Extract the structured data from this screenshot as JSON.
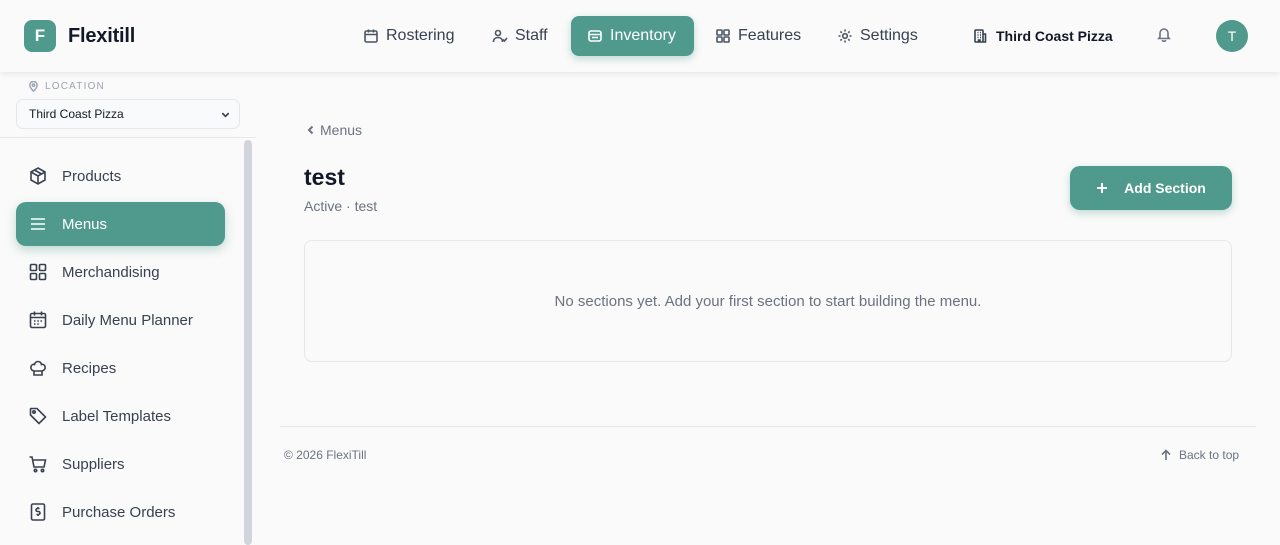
{
  "brand": {
    "logo_letter": "F",
    "name": "Flexitill"
  },
  "nav": {
    "items": [
      {
        "label": "Rostering",
        "icon": "calendar-icon"
      },
      {
        "label": "Staff",
        "icon": "users-icon"
      },
      {
        "label": "Inventory",
        "icon": "box-icon"
      },
      {
        "label": "Features",
        "icon": "grid-icon"
      },
      {
        "label": "Settings",
        "icon": "gear-icon"
      }
    ],
    "active": "Inventory",
    "location_button": "Third Coast Pizza",
    "avatar_letter": "T"
  },
  "sidebar": {
    "location_label": "LOCATION",
    "location_value": "Third Coast Pizza",
    "items": [
      {
        "label": "Products",
        "icon": "package-icon"
      },
      {
        "label": "Menus",
        "icon": "menu-icon"
      },
      {
        "label": "Merchandising",
        "icon": "grid-icon"
      },
      {
        "label": "Daily Menu Planner",
        "icon": "calendar-icon"
      },
      {
        "label": "Recipes",
        "icon": "chef-hat-icon"
      },
      {
        "label": "Label Templates",
        "icon": "tag-icon"
      },
      {
        "label": "Suppliers",
        "icon": "cart-icon"
      },
      {
        "label": "Purchase Orders",
        "icon": "receipt-icon"
      }
    ],
    "active": "Menus"
  },
  "main": {
    "breadcrumb": "Menus",
    "title": "test",
    "subtitle": "Active · test",
    "add_button": "Add Section",
    "empty_message": "No sections yet. Add your first section to start building the menu."
  },
  "footer": {
    "copyright": "© 2026 FlexiTill",
    "back_to_top": "Back to top"
  },
  "colors": {
    "accent": "#4f9a8d",
    "background": "#fafafa",
    "border": "#e5e7eb",
    "muted_text": "#6b7280"
  }
}
